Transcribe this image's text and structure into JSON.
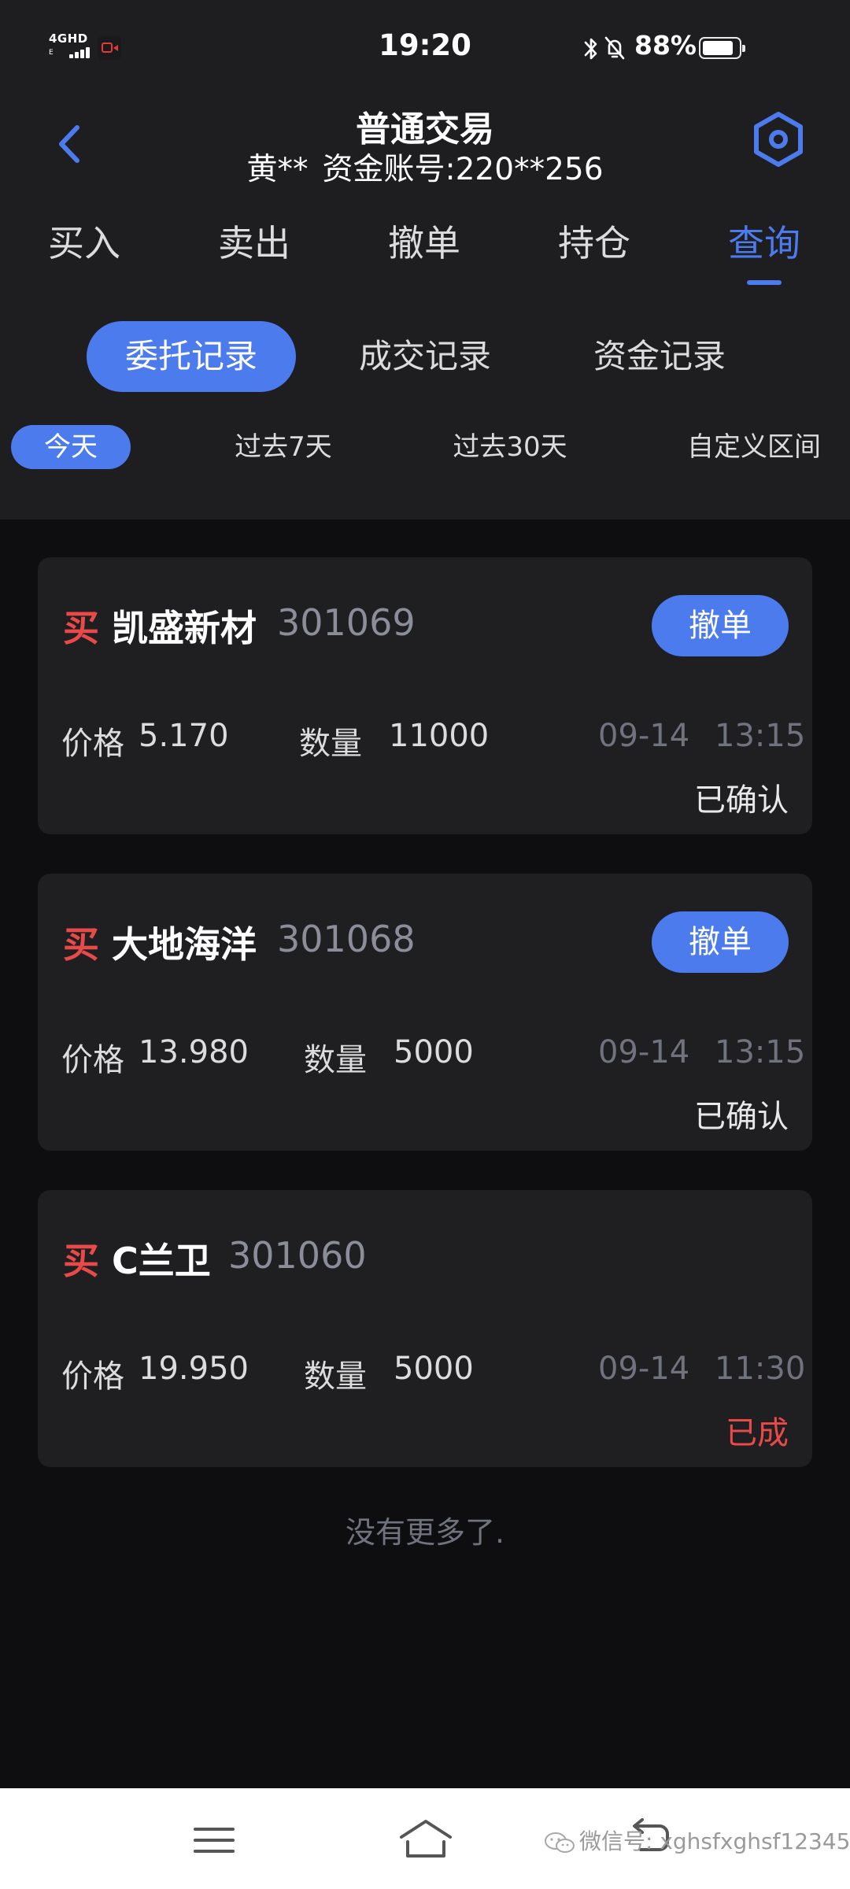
{
  "status_bar": {
    "network": "4GHD",
    "time": "19:20",
    "battery_percent": "88%",
    "battery_level": 0.88
  },
  "header": {
    "title": "普通交易",
    "account_name": "黄**",
    "account_number": "资金账号:220**256"
  },
  "main_tabs": [
    "买入",
    "卖出",
    "撤单",
    "持仓",
    "查询"
  ],
  "main_tab_active": "查询",
  "sub_tabs": [
    "委托记录",
    "成交记录",
    "资金记录"
  ],
  "sub_tab_active": "委托记录",
  "date_tabs": [
    "今天",
    "过去7天",
    "过去30天",
    "自定义区间"
  ],
  "date_tab_active": "今天",
  "orders": [
    {
      "side": "买",
      "name": "凯盛新材",
      "code": "301069",
      "price_label": "价格",
      "price": "5.170",
      "qty_label": "数量",
      "qty": "11000",
      "date": "09-14",
      "time": "13:15",
      "status": "已确认",
      "action": "撤单"
    },
    {
      "side": "买",
      "name": "大地海洋",
      "code": "301068",
      "price_label": "价格",
      "price": "13.980",
      "qty_label": "数量",
      "qty": "5000",
      "date": "09-14",
      "time": "13:15",
      "status": "已确认",
      "action": "撤单"
    },
    {
      "side": "买",
      "name": "C兰卫",
      "code": "301060",
      "price_label": "价格",
      "price": "19.950",
      "qty_label": "数量",
      "qty": "5000",
      "date": "09-14",
      "time": "11:30",
      "status": "已成",
      "action": ""
    }
  ],
  "list_footer": "没有更多了.",
  "watermark": "微信号: xghsfxghsf12345",
  "colors": {
    "accent": "#4b7bec",
    "buy": "#e84a4a",
    "background": "#0e0e10",
    "panel": "#1e1e21",
    "card": "#1f1f22",
    "muted": "#70737d"
  }
}
